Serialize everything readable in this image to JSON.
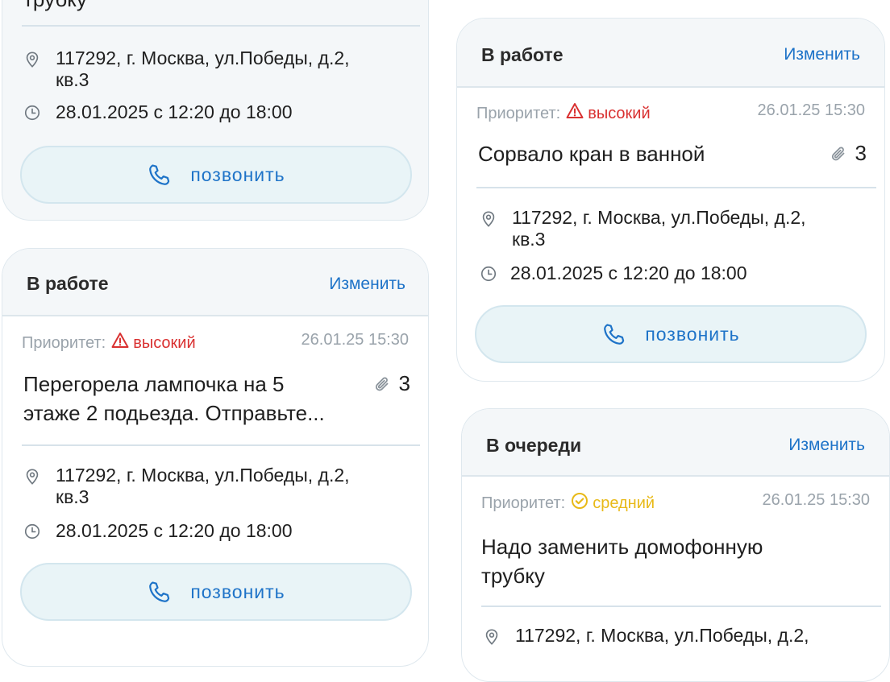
{
  "labels": {
    "edit": "Изменить",
    "priority": "Приоритет:",
    "call": "позвонить"
  },
  "colors": {
    "accent": "#1e73c8",
    "high": "#d93030",
    "medium": "#e8b917",
    "card_bg": "#f4f7f9",
    "button_bg": "#e9f4f7"
  },
  "cards": [
    {
      "title_tail": "трубку",
      "address_line1": "117292, г. Москва,  ул.Победы, д.2,",
      "address_line2": "кв.3",
      "time": "28.01.2025 с 12:20 до 18:00"
    },
    {
      "status": "В работе",
      "priority": "высокий",
      "priority_icon": "warning-icon",
      "date": "26.01.25 15:30",
      "title_line1": "Перегорела лампочка на 5",
      "title_line2": "этаже 2 подьезда. Отправьте...",
      "attachments": "3",
      "address_line1": "117292, г. Москва,  ул.Победы, д.2,",
      "address_line2": "кв.3",
      "time": "28.01.2025 с 12:20 до 18:00"
    },
    {
      "status": "В работе",
      "priority": "высокий",
      "priority_icon": "warning-icon",
      "date": "26.01.25 15:30",
      "title_line1": "Сорвало кран в ванной",
      "attachments": "3",
      "address_line1": "117292, г. Москва,  ул.Победы, д.2,",
      "address_line2": "кв.3",
      "time": "28.01.2025 с 12:20 до 18:00"
    },
    {
      "status": "В очереди",
      "priority": "средний",
      "priority_icon": "check-circle-icon",
      "date": "26.01.25 15:30",
      "title_line1": "Надо заменить домофонную",
      "title_line2": "трубку",
      "address_partial": "117292, г. Москва,  ул.Победы, д.2,"
    }
  ]
}
